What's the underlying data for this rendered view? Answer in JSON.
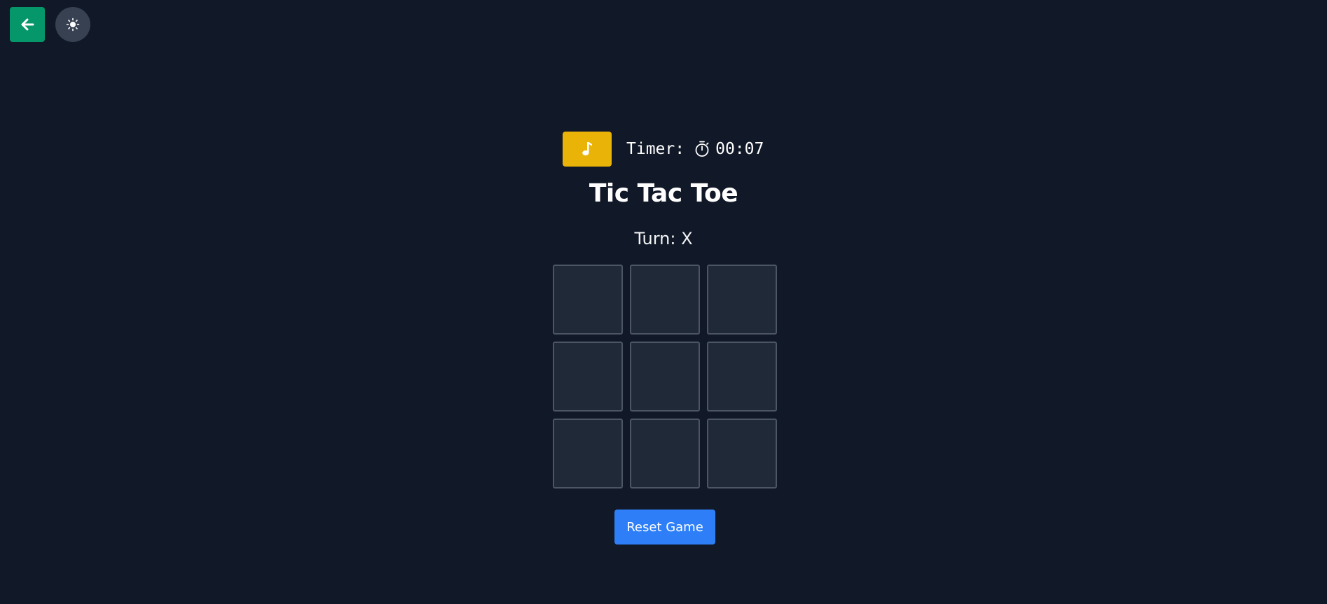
{
  "nav": {
    "back_icon": "arrow-left-icon",
    "theme_icon": "sun-icon"
  },
  "controls": {
    "music_icon": "music-note-icon",
    "timer_label": "Timer:",
    "timer_icon": "stopwatch-icon",
    "timer_value": "00:07"
  },
  "game": {
    "title": "Tic Tac Toe",
    "turn_text": "Turn: X",
    "cells": [
      "",
      "",
      "",
      "",
      "",
      "",
      "",
      "",
      ""
    ]
  },
  "actions": {
    "reset_label": "Reset Game"
  },
  "colors": {
    "background": "#111827",
    "back_button": "#059669",
    "theme_button": "#374151",
    "music_button": "#eab308",
    "cell_fill": "#1f2937",
    "cell_border": "#4b5563",
    "reset_button": "#2e7ff7"
  }
}
